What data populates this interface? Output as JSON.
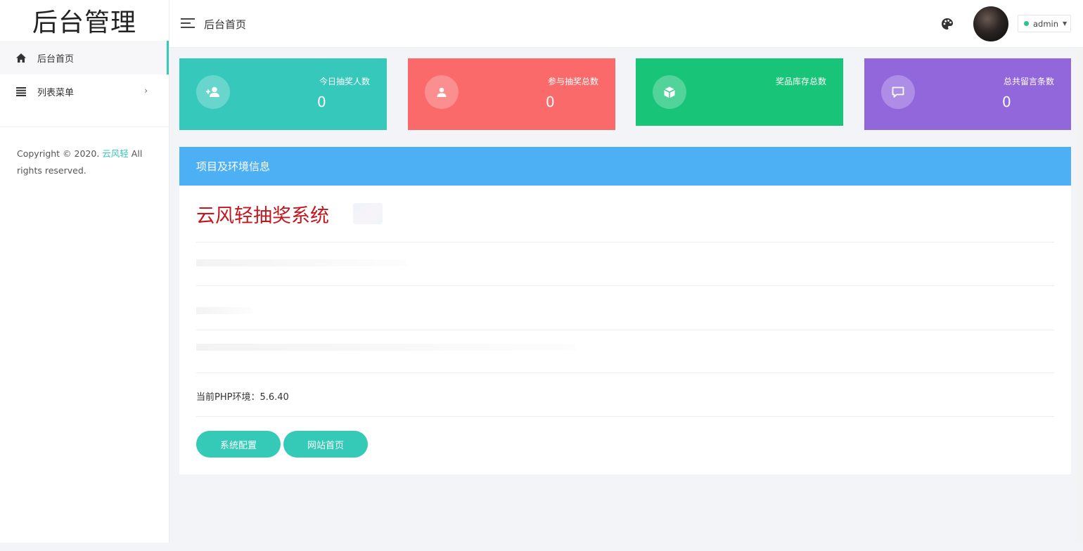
{
  "sidebar": {
    "logo": "后台管理",
    "items": [
      {
        "label": "后台首页",
        "icon": "home-icon",
        "active": true
      },
      {
        "label": "列表菜单",
        "icon": "list-icon",
        "has_children": true
      }
    ],
    "copyright_prefix": "Copyright © 2020.",
    "copyright_brand": "云风轻",
    "copyright_suffix": "All rights reserved."
  },
  "header": {
    "breadcrumb": "后台首页",
    "user": {
      "name": "admin",
      "status_color": "#2bc48a"
    }
  },
  "stats": [
    {
      "label": "今日抽奖人数",
      "value": "0",
      "color": "#36c9bb",
      "icon": "user-plus-icon"
    },
    {
      "label": "参与抽奖总数",
      "value": "0",
      "color": "#fa6a6a",
      "icon": "user-icon"
    },
    {
      "label": "奖品库存总数",
      "value": "",
      "color": "#18c578",
      "icon": "cube-icon"
    },
    {
      "label": "总共留言条数",
      "value": "0",
      "color": "#9267dc",
      "icon": "comment-icon"
    }
  ],
  "panel": {
    "title": "项目及环境信息",
    "system_name": "云风轻抽奖系统",
    "php_env": "当前PHP环境：5.6.40",
    "buttons": {
      "config": "系统配置",
      "home": "网站首页"
    },
    "accent_color": "#35c9b8",
    "header_color": "#4daff4"
  }
}
